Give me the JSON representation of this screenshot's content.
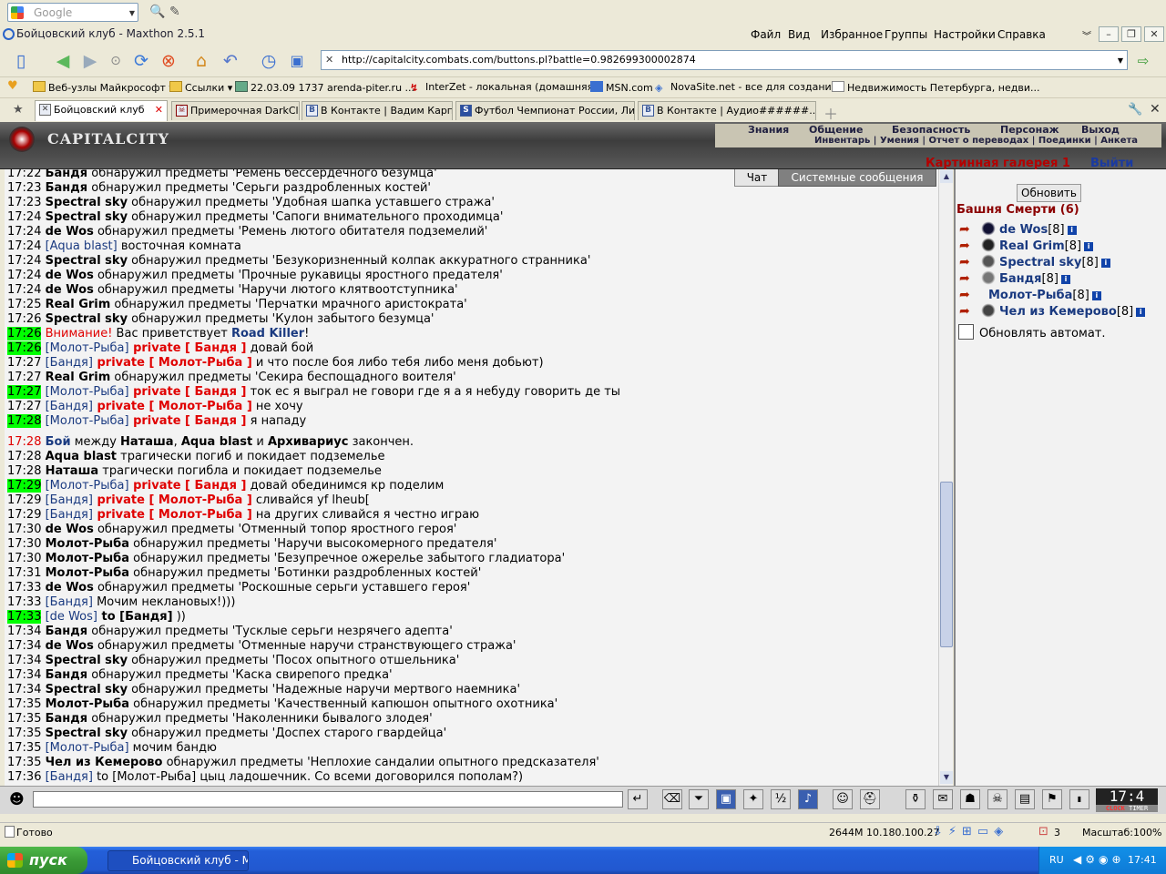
{
  "google_bar": {
    "search_placeholder": "Google"
  },
  "window": {
    "title": "Бойцовский клуб - Maxthon 2.5.1",
    "menu": [
      "Файл",
      "Вид",
      "Избранное",
      "Группы",
      "Настройки",
      "Справка"
    ]
  },
  "address_bar": {
    "url": "http://capitalcity.combats.com/buttons.pl?battle=0.982699300002874"
  },
  "favorites": [
    "Веб-узлы Майкрософт",
    "Ссылки",
    "22.03.09 1737 arenda-piter.ru ...",
    "InterZet - локальная (домашняя...",
    "MSN.com",
    "NovaSite.net - все для создани...",
    "Недвижимость Петербурга, недви..."
  ],
  "tabs": [
    "Бойцовский клуб",
    "Примерочная DarkClan",
    "В Контакте | Вадим Карпов",
    "Футбол Чемпионат России, Лиг...",
    "В Контакте | Аудио######..."
  ],
  "game": {
    "logo": "CAPITALCITY",
    "nav_row1": [
      "Знания",
      "Общение",
      "Безопасность",
      "Персонаж",
      "Выход"
    ],
    "nav_row2": "Инвентарь | Умения | Отчет о переводах | Поединки | Анкета",
    "gallery": "Картинная галерея 1",
    "exit": "Выйти",
    "chat_tab": "Чат",
    "system_tab": "Системные сообщения"
  },
  "chat": {
    "lines": [
      {
        "time": "17:22",
        "hl": false,
        "parts": [
          [
            "n",
            "Бандя"
          ],
          [
            "t",
            " обнаружил предметы 'Ремень бессердечного безумца'"
          ]
        ]
      },
      {
        "time": "17:23",
        "hl": false,
        "parts": [
          [
            "n",
            "Бандя"
          ],
          [
            "t",
            " обнаружил предметы 'Серьги раздробленных костей'"
          ]
        ]
      },
      {
        "time": "17:23",
        "hl": false,
        "parts": [
          [
            "n",
            "Spectral sky"
          ],
          [
            "t",
            " обнаружил предметы 'Удобная шапка уставшего стража'"
          ]
        ]
      },
      {
        "time": "17:24",
        "hl": false,
        "parts": [
          [
            "n",
            "Spectral sky"
          ],
          [
            "t",
            " обнаружил предметы 'Сапоги внимательного проходимца'"
          ]
        ]
      },
      {
        "time": "17:24",
        "hl": false,
        "parts": [
          [
            "n",
            "de Wos"
          ],
          [
            "t",
            " обнаружил предметы 'Ремень лютого обитателя подземелий'"
          ]
        ]
      },
      {
        "time": "17:24",
        "hl": false,
        "parts": [
          [
            "b",
            "[Aqua blast]"
          ],
          [
            "t",
            " восточная комната"
          ]
        ]
      },
      {
        "time": "17:24",
        "hl": false,
        "parts": [
          [
            "n",
            "Spectral sky"
          ],
          [
            "t",
            " обнаружил предметы 'Безукоризненный колпак аккуратного странника'"
          ]
        ]
      },
      {
        "time": "17:24",
        "hl": false,
        "parts": [
          [
            "n",
            "de Wos"
          ],
          [
            "t",
            " обнаружил предметы 'Прочные рукавицы яростного предателя'"
          ]
        ]
      },
      {
        "time": "17:24",
        "hl": false,
        "parts": [
          [
            "n",
            "de Wos"
          ],
          [
            "t",
            " обнаружил предметы 'Наручи лютого клятвоотступника'"
          ]
        ]
      },
      {
        "time": "17:25",
        "hl": false,
        "parts": [
          [
            "n",
            "Real Grim"
          ],
          [
            "t",
            " обнаружил предметы 'Перчатки мрачного аристократа'"
          ]
        ]
      },
      {
        "time": "17:26",
        "hl": false,
        "parts": [
          [
            "n",
            "Spectral sky"
          ],
          [
            "t",
            " обнаружил предметы 'Кулон забытого безумца'"
          ]
        ]
      },
      {
        "time": "17:26",
        "hl": true,
        "parts": [
          [
            "r",
            "Внимание!"
          ],
          [
            "t",
            " Вас приветствует "
          ],
          [
            "bn",
            "Road Killer"
          ],
          [
            "t",
            "!"
          ]
        ]
      },
      {
        "time": "17:26",
        "hl": true,
        "parts": [
          [
            "b",
            "[Молот-Рыба]"
          ],
          [
            "p",
            " private [ Бандя ]"
          ],
          [
            "t",
            " довай бой"
          ]
        ]
      },
      {
        "time": "17:27",
        "hl": false,
        "parts": [
          [
            "b",
            "[Бандя]"
          ],
          [
            "p",
            " private [ Молот-Рыба ]"
          ],
          [
            "t",
            " и что после боя либо тебя либо меня добьют)"
          ]
        ]
      },
      {
        "time": "17:27",
        "hl": false,
        "parts": [
          [
            "n",
            "Real Grim"
          ],
          [
            "t",
            " обнаружил предметы 'Секира беспощадного воителя'"
          ]
        ]
      },
      {
        "time": "17:27",
        "hl": true,
        "parts": [
          [
            "b",
            "[Молот-Рыба]"
          ],
          [
            "p",
            " private [ Бандя ]"
          ],
          [
            "t",
            " ток ес я выграл не говори где я а я небуду говорить де ты"
          ]
        ]
      },
      {
        "time": "17:27",
        "hl": false,
        "parts": [
          [
            "b",
            "[Бандя]"
          ],
          [
            "p",
            " private [ Молот-Рыба ]"
          ],
          [
            "t",
            " не хочу"
          ]
        ]
      },
      {
        "time": "17:28",
        "hl": true,
        "parts": [
          [
            "b",
            "[Молот-Рыба]"
          ],
          [
            "p",
            " private [ Бандя ]"
          ],
          [
            "t",
            " я нападу"
          ]
        ]
      },
      {
        "time": "17:28",
        "hl": false,
        "red": true,
        "parts": [
          [
            "bn",
            "Бой"
          ],
          [
            "t",
            " между "
          ],
          [
            "n",
            "Наташа"
          ],
          [
            "t",
            ", "
          ],
          [
            "n",
            "Aqua blast"
          ],
          [
            "t",
            " и "
          ],
          [
            "n",
            "Архивариус"
          ],
          [
            "t",
            "  закончен."
          ]
        ]
      },
      {
        "time": "17:28",
        "hl": false,
        "parts": [
          [
            "n",
            "Aqua blast"
          ],
          [
            "t",
            " трагически погиб и покидает подземелье"
          ]
        ]
      },
      {
        "time": "17:28",
        "hl": false,
        "parts": [
          [
            "n",
            "Наташа"
          ],
          [
            "t",
            " трагически погибла и покидает подземелье"
          ]
        ]
      },
      {
        "time": "17:29",
        "hl": true,
        "parts": [
          [
            "b",
            "[Молот-Рыба]"
          ],
          [
            "p",
            " private [ Бандя ]"
          ],
          [
            "t",
            " довай обединимся кр поделим"
          ]
        ]
      },
      {
        "time": "17:29",
        "hl": false,
        "parts": [
          [
            "b",
            "[Бандя]"
          ],
          [
            "p",
            " private [ Молот-Рыба ]"
          ],
          [
            "t",
            " сливайся yf lheub["
          ]
        ]
      },
      {
        "time": "17:29",
        "hl": false,
        "parts": [
          [
            "b",
            "[Бандя]"
          ],
          [
            "p",
            " private [ Молот-Рыба ]"
          ],
          [
            "t",
            " на других сливайся я честно играю"
          ]
        ]
      },
      {
        "time": "17:30",
        "hl": false,
        "parts": [
          [
            "n",
            "de Wos"
          ],
          [
            "t",
            " обнаружил предметы 'Отменный топор яростного героя'"
          ]
        ]
      },
      {
        "time": "17:30",
        "hl": false,
        "parts": [
          [
            "n",
            "Молот-Рыба"
          ],
          [
            "t",
            " обнаружил предметы 'Наручи высокомерного предателя'"
          ]
        ]
      },
      {
        "time": "17:30",
        "hl": false,
        "parts": [
          [
            "n",
            "Молот-Рыба"
          ],
          [
            "t",
            " обнаружил предметы 'Безупречное ожерелье забытого гладиатора'"
          ]
        ]
      },
      {
        "time": "17:31",
        "hl": false,
        "parts": [
          [
            "n",
            "Молот-Рыба"
          ],
          [
            "t",
            " обнаружил предметы 'Ботинки раздробленных костей'"
          ]
        ]
      },
      {
        "time": "17:33",
        "hl": false,
        "parts": [
          [
            "n",
            "de Wos"
          ],
          [
            "t",
            " обнаружил предметы 'Роскошные серьги уставшего героя'"
          ]
        ]
      },
      {
        "time": "17:33",
        "hl": false,
        "parts": [
          [
            "b",
            "[Бандя]"
          ],
          [
            "t",
            " Мочим некланoвых!)))"
          ]
        ]
      },
      {
        "time": "17:33",
        "hl": true,
        "parts": [
          [
            "b",
            "[de Wos]"
          ],
          [
            "n",
            " to [Бандя]"
          ],
          [
            "t",
            " ))"
          ]
        ]
      },
      {
        "time": "17:34",
        "hl": false,
        "parts": [
          [
            "n",
            "Бандя"
          ],
          [
            "t",
            " обнаружил предметы 'Тусклые серьги незрячего адепта'"
          ]
        ]
      },
      {
        "time": "17:34",
        "hl": false,
        "parts": [
          [
            "n",
            "de Wos"
          ],
          [
            "t",
            " обнаружил предметы 'Отменные наручи странствующего стража'"
          ]
        ]
      },
      {
        "time": "17:34",
        "hl": false,
        "parts": [
          [
            "n",
            "Spectral sky"
          ],
          [
            "t",
            " обнаружил предметы 'Посох опытного отшельника'"
          ]
        ]
      },
      {
        "time": "17:34",
        "hl": false,
        "parts": [
          [
            "n",
            "Бандя"
          ],
          [
            "t",
            " обнаружил предметы 'Каска свирепого предка'"
          ]
        ]
      },
      {
        "time": "17:34",
        "hl": false,
        "parts": [
          [
            "n",
            "Spectral sky"
          ],
          [
            "t",
            " обнаружил предметы 'Надежные наручи мертвого наемника'"
          ]
        ]
      },
      {
        "time": "17:35",
        "hl": false,
        "parts": [
          [
            "n",
            "Молот-Рыба"
          ],
          [
            "t",
            " обнаружил предметы 'Качественный капюшон опытного охотника'"
          ]
        ]
      },
      {
        "time": "17:35",
        "hl": false,
        "parts": [
          [
            "n",
            "Бандя"
          ],
          [
            "t",
            " обнаружил предметы 'Наколенники бывалого злодея'"
          ]
        ]
      },
      {
        "time": "17:35",
        "hl": false,
        "parts": [
          [
            "n",
            "Spectral sky"
          ],
          [
            "t",
            " обнаружил предметы 'Доспех старого гвардейца'"
          ]
        ]
      },
      {
        "time": "17:35",
        "hl": false,
        "parts": [
          [
            "b",
            "[Молот-Рыба]"
          ],
          [
            "t",
            " мочим бандю"
          ]
        ]
      },
      {
        "time": "17:35",
        "hl": false,
        "parts": [
          [
            "n",
            "Чел из Кемерово"
          ],
          [
            "t",
            " обнаружил предметы 'Неплохие сандалии опытного предсказателя'"
          ]
        ]
      },
      {
        "time": "17:36",
        "hl": false,
        "parts": [
          [
            "b",
            "[Бандя]"
          ],
          [
            "t",
            " to [Молот-Рыба] цыц ладошечник. Со всеми договорился пополам?)"
          ]
        ]
      }
    ]
  },
  "panel": {
    "refresh": "Обновить",
    "tower_title": "Башня Смерти (6)",
    "players": [
      {
        "name": "de Wos",
        "level": "[8]"
      },
      {
        "name": "Real Grim",
        "level": "[8]"
      },
      {
        "name": "Spectral sky",
        "level": "[8]"
      },
      {
        "name": "Бандя",
        "level": "[8]"
      },
      {
        "name": "Молот-Рыба",
        "level": "[8]"
      },
      {
        "name": "Чел из Кемерово",
        "level": "[8]"
      }
    ],
    "auto_refresh_label": "Обновлять автомат."
  },
  "clock": {
    "time": "17:4",
    "label1": "CLOCK",
    "label2": "TIMER"
  },
  "status_bar": {
    "text": "Готово",
    "info": "2644M 10.180.100.27",
    "zoom": "Масштаб:100%"
  },
  "taskbar": {
    "start": "пуск",
    "task": "Бойцовский клуб - М...",
    "lang": "RU",
    "time": "17:41"
  }
}
